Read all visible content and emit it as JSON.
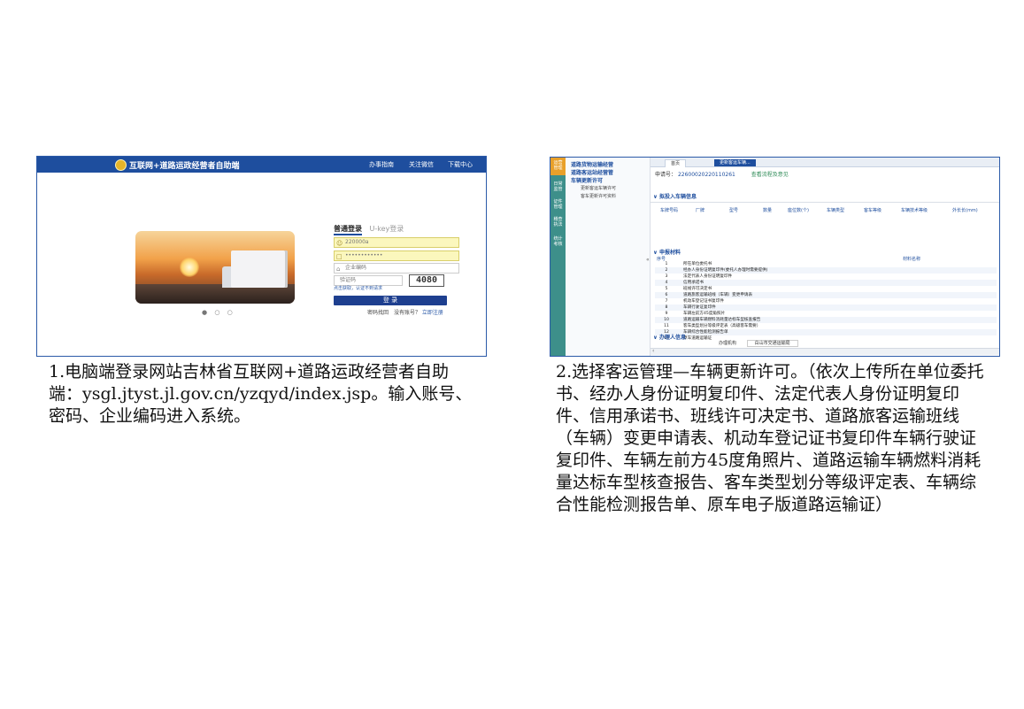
{
  "left_shot": {
    "title": "互联网+道路运政经营者自助端",
    "nav": [
      "办事指南",
      "关注微信",
      "下载中心"
    ],
    "tabs": [
      "普通登录",
      "U-key登录"
    ],
    "account_value": "220000a",
    "password_value": "••••••••••••",
    "company_code_placeholder": "企业编码",
    "captcha_placeholder": "验证码",
    "captcha_code": "4080",
    "fine_print": "点击获取，认证不到请求",
    "login_button": "登 录",
    "forgot_link": "密码找回",
    "no_account": "没有账号？",
    "register_link": "立即注册",
    "carousel_dots": "● ○ ○"
  },
  "right_shot": {
    "sidebar_labels": [
      "运营管理",
      "日常监管",
      "证件管理",
      "稽查执法",
      "统计考核"
    ],
    "tree_items": [
      "道路货物运输经营",
      "道路客运站经营管",
      "车辆更新许可"
    ],
    "tree_subitems": [
      "更新客运车辆许可",
      "客车更新许可资料"
    ],
    "tabs": [
      "首页",
      "更新客运车辆..."
    ],
    "application_label": "申请号：",
    "application_no": "22600020220110261",
    "view_link": "查看流程及意见",
    "section_vehicle": "拟投入车辆信息",
    "vehicle_columns": [
      "车牌号码",
      "厂牌",
      "型号",
      "数量",
      "座位数(个)",
      "车辆类型",
      "客车等级",
      "车辆技术等级",
      "外长长(mm)"
    ],
    "section_materials": "申报材料",
    "materials_columns": [
      "序号",
      "材料名称"
    ],
    "materials": [
      {
        "no": "1",
        "name": "所在单位委托书"
      },
      {
        "no": "2",
        "name": "经办人身份证明复印件(委托人办理时需要提供)"
      },
      {
        "no": "3",
        "name": "法定代表人身份证明复印件"
      },
      {
        "no": "4",
        "name": "信用承诺书"
      },
      {
        "no": "5",
        "name": "班线许可决定书"
      },
      {
        "no": "6",
        "name": "道路旅客运输班线（车辆）变更申请表"
      },
      {
        "no": "7",
        "name": "机动车登记证书复印件"
      },
      {
        "no": "8",
        "name": "车辆行驶证复印件"
      },
      {
        "no": "9",
        "name": "车辆左前方45度角照片"
      },
      {
        "no": "10",
        "name": "道路运输车辆燃料消耗量达标车型核查报告"
      },
      {
        "no": "11",
        "name": "客车类型划分等级评定表（高级客车需要）"
      },
      {
        "no": "12",
        "name": "车辆综合性能检测报告单"
      },
      {
        "no": "13",
        "name": "原车道路运输证"
      }
    ],
    "section_handler": "办理人信息",
    "handler_label": "办理机构",
    "handler_value": "白山市交通运输局"
  },
  "captions": {
    "left": "1.电脑端登录网站吉林省互联网+道路运政经营者自助端：ysgl.jtyst.jl.gov.cn/yzqyd/index.jsp。输入账号、密码、企业编码进入系统。",
    "right": "2.选择客运管理—车辆更新许可。（依次上传所在单位委托书、经办人身份证明复印件、法定代表人身份证明复印件、信用承诺书、班线许可决定书、道路旅客运输班线（车辆）变更申请表、机动车登记证书复印件车辆行驶证复印件、车辆左前方45度角照片、道路运输车辆燃料消耗量达标车型核查报告、客车类型划分等级评定表、车辆综合性能检测报告单、原车电子版道路运输证）"
  }
}
